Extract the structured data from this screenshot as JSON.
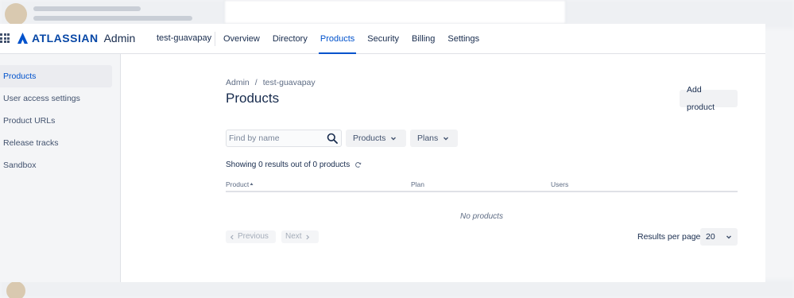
{
  "top_nav": {
    "brand": "ATLASSIAN",
    "product": "Admin",
    "org": "test-guavapay",
    "tabs": [
      {
        "label": "Overview",
        "active": false
      },
      {
        "label": "Directory",
        "active": false
      },
      {
        "label": "Products",
        "active": true
      },
      {
        "label": "Security",
        "active": false
      },
      {
        "label": "Billing",
        "active": false
      },
      {
        "label": "Settings",
        "active": false
      }
    ]
  },
  "sidebar": {
    "items": [
      {
        "label": "Products",
        "active": true
      },
      {
        "label": "User access settings",
        "active": false
      },
      {
        "label": "Product URLs",
        "active": false
      },
      {
        "label": "Release tracks",
        "active": false
      },
      {
        "label": "Sandbox",
        "active": false
      }
    ]
  },
  "main": {
    "breadcrumb": [
      "Admin",
      "/",
      "test-guavapay"
    ],
    "title": "Products",
    "add_button": "Add product",
    "search_placeholder": "Find by name",
    "filters": {
      "products": "Products",
      "plans": "Plans"
    },
    "results_text": "Showing 0 results out of 0 products",
    "columns": {
      "product": "Product",
      "plan": "Plan",
      "users": "Users"
    },
    "empty_text": "No products",
    "pagination": {
      "previous": "Previous",
      "next": "Next"
    },
    "rows_per_page_label": "Results per page:",
    "rows_per_page_value": "20"
  },
  "colors": {
    "accent": "#0052cc",
    "brand": "#0747a6",
    "text": "#172b4d",
    "muted": "#5e6c84",
    "sidebar_bg": "#f4f5f7"
  }
}
